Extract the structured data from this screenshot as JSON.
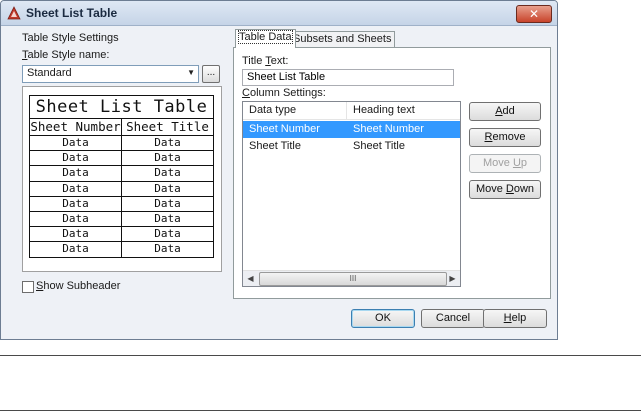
{
  "window": {
    "title": "Sheet List Table",
    "close_glyph": "✕"
  },
  "left_panel": {
    "group_label": "Table Style Settings",
    "style_name_label_u": "T",
    "style_name_label_rest": "able Style name:",
    "style_value": "Standard",
    "ellipsis_label": "...",
    "preview": {
      "title": "Sheet List Table",
      "headers": [
        "Sheet Number",
        "Sheet Title"
      ],
      "cell": "Data",
      "row_count": 8
    },
    "show_subheader_u": "S",
    "show_subheader_rest": "how Subheader"
  },
  "tabs": [
    {
      "label": "Table Data",
      "active": true
    },
    {
      "label": "Subsets and Sheets",
      "active": false
    }
  ],
  "table_data": {
    "title_text_label_pre": "Title ",
    "title_text_label_u": "T",
    "title_text_label_post": "ext:",
    "title_text_value": "Sheet List Table",
    "column_settings_label_u": "C",
    "column_settings_label_rest": "olumn Settings:",
    "columns": {
      "data_type": "Data type",
      "heading_text": "Heading text"
    },
    "rows": [
      {
        "data_type": "Sheet Number",
        "heading_text": "Sheet Number",
        "selected": true
      },
      {
        "data_type": "Sheet Title",
        "heading_text": "Sheet Title",
        "selected": false
      }
    ],
    "scroll": {
      "left_arrow": "◀",
      "right_arrow": "▶",
      "thumb_grip": "III"
    }
  },
  "side_buttons": {
    "add": {
      "u": "A",
      "rest": "dd"
    },
    "remove": {
      "u": "R",
      "rest": "emove"
    },
    "move_up": {
      "pre": "Move ",
      "u": "U",
      "rest": "p",
      "disabled": true
    },
    "move_down": {
      "pre": "Move ",
      "u": "D",
      "rest": "own"
    }
  },
  "footer": {
    "ok": "OK",
    "cancel": "Cancel",
    "help_u": "H",
    "help_rest": "elp"
  },
  "colors": {
    "selection": "#3399ff",
    "dialog_bg": "#eef1f6",
    "close_red": "#c8432b"
  }
}
